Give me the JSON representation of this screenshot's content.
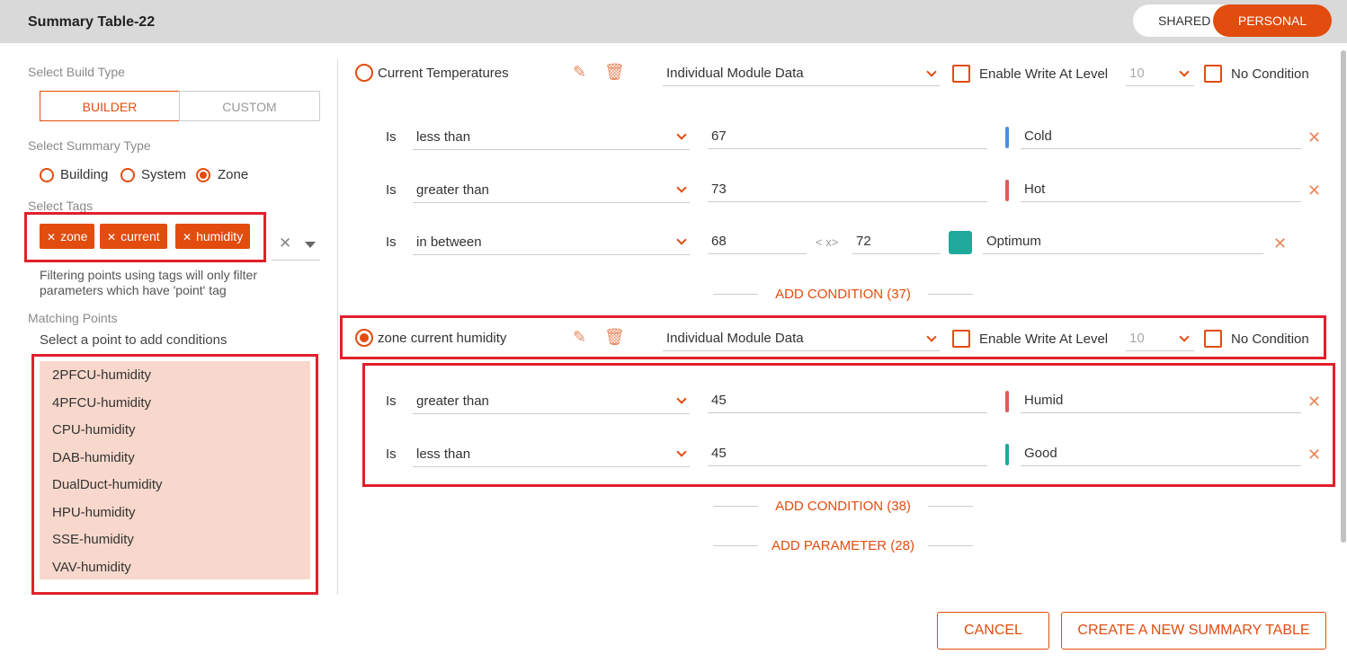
{
  "header": {
    "title": "Summary Table-22",
    "shared_label": "SHARED",
    "personal_label": "PERSONAL"
  },
  "left": {
    "build_type_label": "Select Build Type",
    "builder_label": "BUILDER",
    "custom_label": "CUSTOM",
    "summary_type_label": "Select Summary Type",
    "summary_types": [
      {
        "label": "Building",
        "selected": false
      },
      {
        "label": "System",
        "selected": false
      },
      {
        "label": "Zone",
        "selected": true
      }
    ],
    "tags_label": "Select Tags",
    "tags": [
      "zone",
      "current",
      "humidity"
    ],
    "filter_note": "Filtering points using tags will only filter parameters which have 'point' tag",
    "filter_note_line1": "Filtering points using tags will only filter",
    "filter_note_line2": "parameters which have 'point' tag",
    "matching_label": "Matching Points",
    "matching_hint": "Select a point to add conditions",
    "points": [
      "2PFCU-humidity",
      "4PFCU-humidity",
      "CPU-humidity",
      "DAB-humidity",
      "DualDuct-humidity",
      "HPU-humidity",
      "SSE-humidity",
      "VAV-humidity"
    ]
  },
  "params": [
    {
      "name": "Current Temperatures",
      "selected": false,
      "data_source": "Individual Module Data",
      "enable_write_label": "Enable Write At Level",
      "level": "10",
      "no_condition_label": "No Condition",
      "conditions": [
        {
          "is": "Is",
          "operator": "less than",
          "value": "67",
          "label": "Cold",
          "color": "#4a90d9"
        },
        {
          "is": "Is",
          "operator": "greater than",
          "value": "73",
          "label": "Hot",
          "color": "#e05a5a"
        },
        {
          "is": "Is",
          "operator": "in between",
          "value": "68",
          "between_sep": "< x>",
          "value2": "72",
          "label": "Optimum",
          "color": "#1fa99a"
        }
      ],
      "add_condition": "ADD CONDITION (37)"
    },
    {
      "name": "zone current humidity",
      "selected": true,
      "data_source": "Individual Module Data",
      "enable_write_label": "Enable Write At Level",
      "level": "10",
      "no_condition_label": "No Condition",
      "conditions": [
        {
          "is": "Is",
          "operator": "greater than",
          "value": "45",
          "label": "Humid",
          "color": "#e05a5a"
        },
        {
          "is": "Is",
          "operator": "less than",
          "value": "45",
          "label": "Good",
          "color": "#1fa99a"
        }
      ],
      "add_condition": "ADD CONDITION (38)"
    }
  ],
  "add_parameter": "ADD PARAMETER (28)",
  "footer": {
    "cancel_label": "CANCEL",
    "create_label": "CREATE A NEW SUMMARY TABLE"
  },
  "colors": {
    "accent": "#e24c0e",
    "highlight_box": "#e0202b",
    "points_bg": "#f8d8cc"
  }
}
